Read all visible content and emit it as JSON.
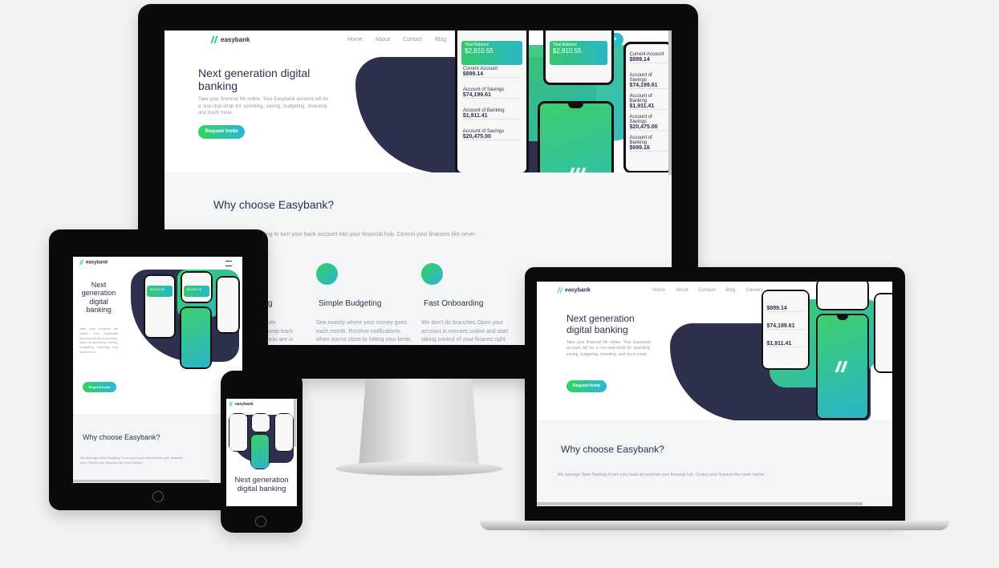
{
  "brand": {
    "name": "easybank"
  },
  "nav": {
    "items": [
      "Home",
      "About",
      "Contact",
      "Blog",
      "Careers"
    ]
  },
  "cta": {
    "label": "Request Invite"
  },
  "hero": {
    "title": "Next generation digital banking",
    "text": "Take your financial life online. Your Easybank account will be a one-stop-shop for spending, saving, budgeting, investing, and much more."
  },
  "why": {
    "title": "Why choose Easybank?",
    "text": "We leverage Open Banking to turn your bank account into your financial hub. Control your finances like never before.",
    "text_partial": "anking to turn your bank account into your financial hub. Control your finances like never"
  },
  "features": [
    {
      "title": "Online Banking",
      "title_partial": "g",
      "text": "Our modern web and mobile applications allow you to keep track of your finances wherever you are in the world.",
      "text_partial": "mobile\n to keep track\nver you are in"
    },
    {
      "title": "Simple Budgeting",
      "text": "See exactly where your money goes each month. Receive notifications when you're close to hitting your limits."
    },
    {
      "title": "Fast Onboarding",
      "text": "We don't do branches.Open your account in minutes online and start taking control of your finaces right away."
    }
  ],
  "phone_ui": {
    "total_label": "Total Balance",
    "total_value": "$2,810.55",
    "rows": [
      {
        "label": "Current Account",
        "value": "$899.14"
      },
      {
        "label": "Account of Savings",
        "value": "$74,199.61"
      },
      {
        "label": "Account of Banking",
        "value": "$1,911.41"
      },
      {
        "label": "Account of Savings",
        "value": "$20,475.00"
      },
      {
        "label": "Account of Banking",
        "value": "$699.16"
      }
    ]
  },
  "colors": {
    "accent_start": "#31d35c",
    "accent_end": "#2bb7da",
    "navy": "#2d314d",
    "muted": "#9698a6"
  },
  "icons": [
    "easybank-logo-icon",
    "online-banking-icon",
    "budgeting-icon",
    "onboarding-icon",
    "phone-glyph-icon"
  ]
}
